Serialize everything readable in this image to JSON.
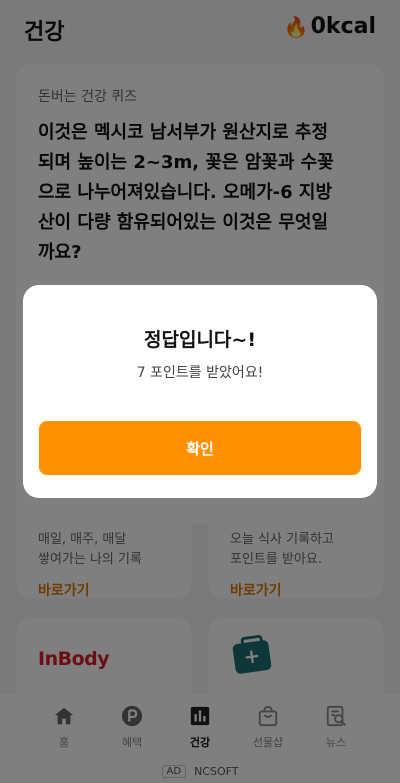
{
  "header": {
    "title": "건강",
    "kcal": "0kcal",
    "kcal_icon": "flame-icon"
  },
  "quiz": {
    "label": "돈버는 건강 퀴즈",
    "question": "이것은 멕시코 남서부가 원산지로 추정되며 높이는 2~3m, 꽃은 암꽃과 수꽃으로 나누어져있습니다. 오메가-6 지방산이 다량 함유되어있는 이것은 무엇일까요?"
  },
  "cards": {
    "left": {
      "desc": "매일, 매주, 매달\n쌓여가는 나의 기록",
      "link": "바로가기"
    },
    "right": {
      "desc": "오늘 식사 기록하고\n포인트를 받아요.",
      "link": "바로가기"
    },
    "bottom_left": {
      "logo_text": "InBody"
    },
    "bottom_right": {
      "icon": "first-aid-kit-icon"
    }
  },
  "nav": {
    "items": [
      {
        "label": "홈",
        "icon": "home-icon"
      },
      {
        "label": "혜택",
        "icon": "point-icon"
      },
      {
        "label": "건강",
        "icon": "chart-icon"
      },
      {
        "label": "선물샵",
        "icon": "shopping-bag-icon"
      },
      {
        "label": "뉴스",
        "icon": "news-icon"
      }
    ],
    "active_index": 2
  },
  "ad": {
    "tag": "AD",
    "text": "NCSOFT"
  },
  "dialog": {
    "title": "정답입니다~!",
    "message": "7 포인트를 받았어요!",
    "confirm_label": "확인"
  },
  "colors": {
    "accent": "#ff9000",
    "link": "#e07800",
    "overlay": "rgba(0,0,0,0.5)"
  }
}
